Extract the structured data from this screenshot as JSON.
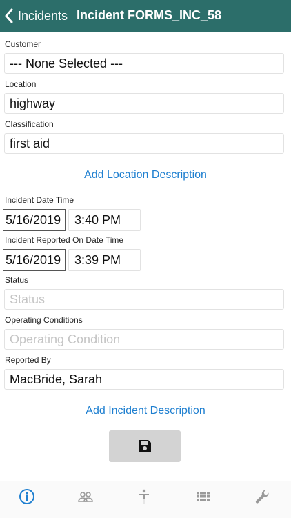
{
  "header": {
    "back_label": "Incidents",
    "title": "Incident FORMS_INC_58"
  },
  "form": {
    "customer": {
      "label": "Customer",
      "value": "--- None Selected ---"
    },
    "location": {
      "label": "Location",
      "value": "highway"
    },
    "classification": {
      "label": "Classification",
      "value": "first aid"
    },
    "add_location_description": "Add Location Description",
    "incident_datetime": {
      "label": "Incident Date Time",
      "date": "5/16/2019",
      "time": "3:40 PM"
    },
    "reported_datetime": {
      "label": "Incident Reported On Date Time",
      "date": "5/16/2019",
      "time": "3:39 PM"
    },
    "status": {
      "label": "Status",
      "placeholder": "Status"
    },
    "operating_conditions": {
      "label": "Operating Conditions",
      "placeholder": "Operating Condition"
    },
    "reported_by": {
      "label": "Reported By",
      "value": "MacBride, Sarah"
    },
    "add_incident_description": "Add Incident Description"
  },
  "save_button": {
    "icon": "save-icon"
  },
  "tabs": [
    {
      "icon": "info-icon",
      "active": true
    },
    {
      "icon": "people-icon",
      "active": false
    },
    {
      "icon": "person-icon",
      "active": false
    },
    {
      "icon": "grid-icon",
      "active": false
    },
    {
      "icon": "wrench-icon",
      "active": false
    }
  ],
  "colors": {
    "header_bg": "#2c6e6a",
    "link": "#1e7fd0",
    "tab_active": "#1e7fd0",
    "tab_inactive": "#9a9a9a"
  }
}
